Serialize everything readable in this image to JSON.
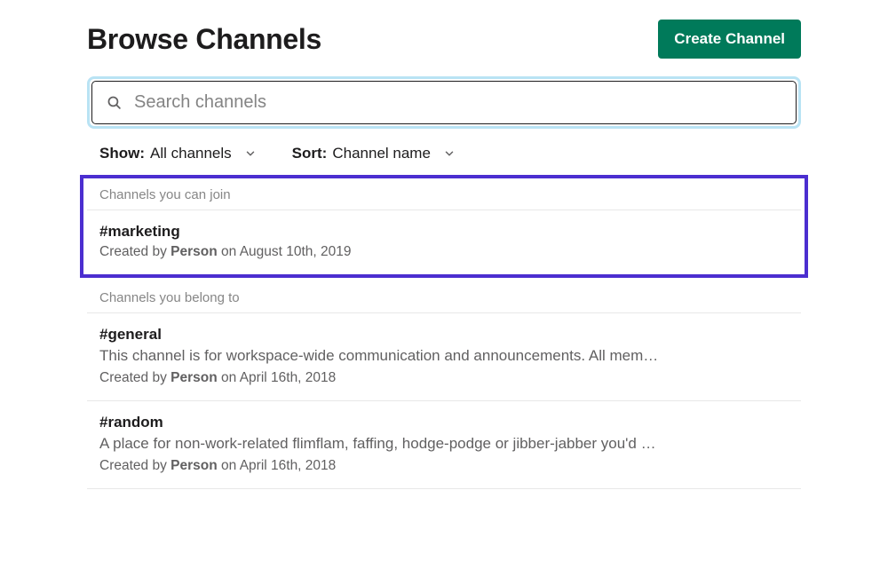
{
  "header": {
    "title": "Browse Channels",
    "create_button": "Create Channel"
  },
  "search": {
    "placeholder": "Search channels"
  },
  "filters": {
    "show_label": "Show:",
    "show_value": "All channels",
    "sort_label": "Sort:",
    "sort_value": "Channel name"
  },
  "sections": {
    "join": {
      "header": "Channels you can join",
      "items": [
        {
          "name": "#marketing",
          "created_prefix": "Created by ",
          "created_person": "Person",
          "created_suffix": " on August 10th, 2019"
        }
      ]
    },
    "belong": {
      "header": "Channels you belong to",
      "items": [
        {
          "name": "#general",
          "description": "This channel is for workspace-wide communication and announcements. All mem…",
          "created_prefix": "Created by ",
          "created_person": "Person",
          "created_suffix": " on April 16th, 2018"
        },
        {
          "name": "#random",
          "description": "A place for non-work-related flimflam, faffing, hodge-podge or jibber-jabber you'd …",
          "created_prefix": "Created by ",
          "created_person": "Person",
          "created_suffix": " on April 16th, 2018"
        }
      ]
    }
  }
}
